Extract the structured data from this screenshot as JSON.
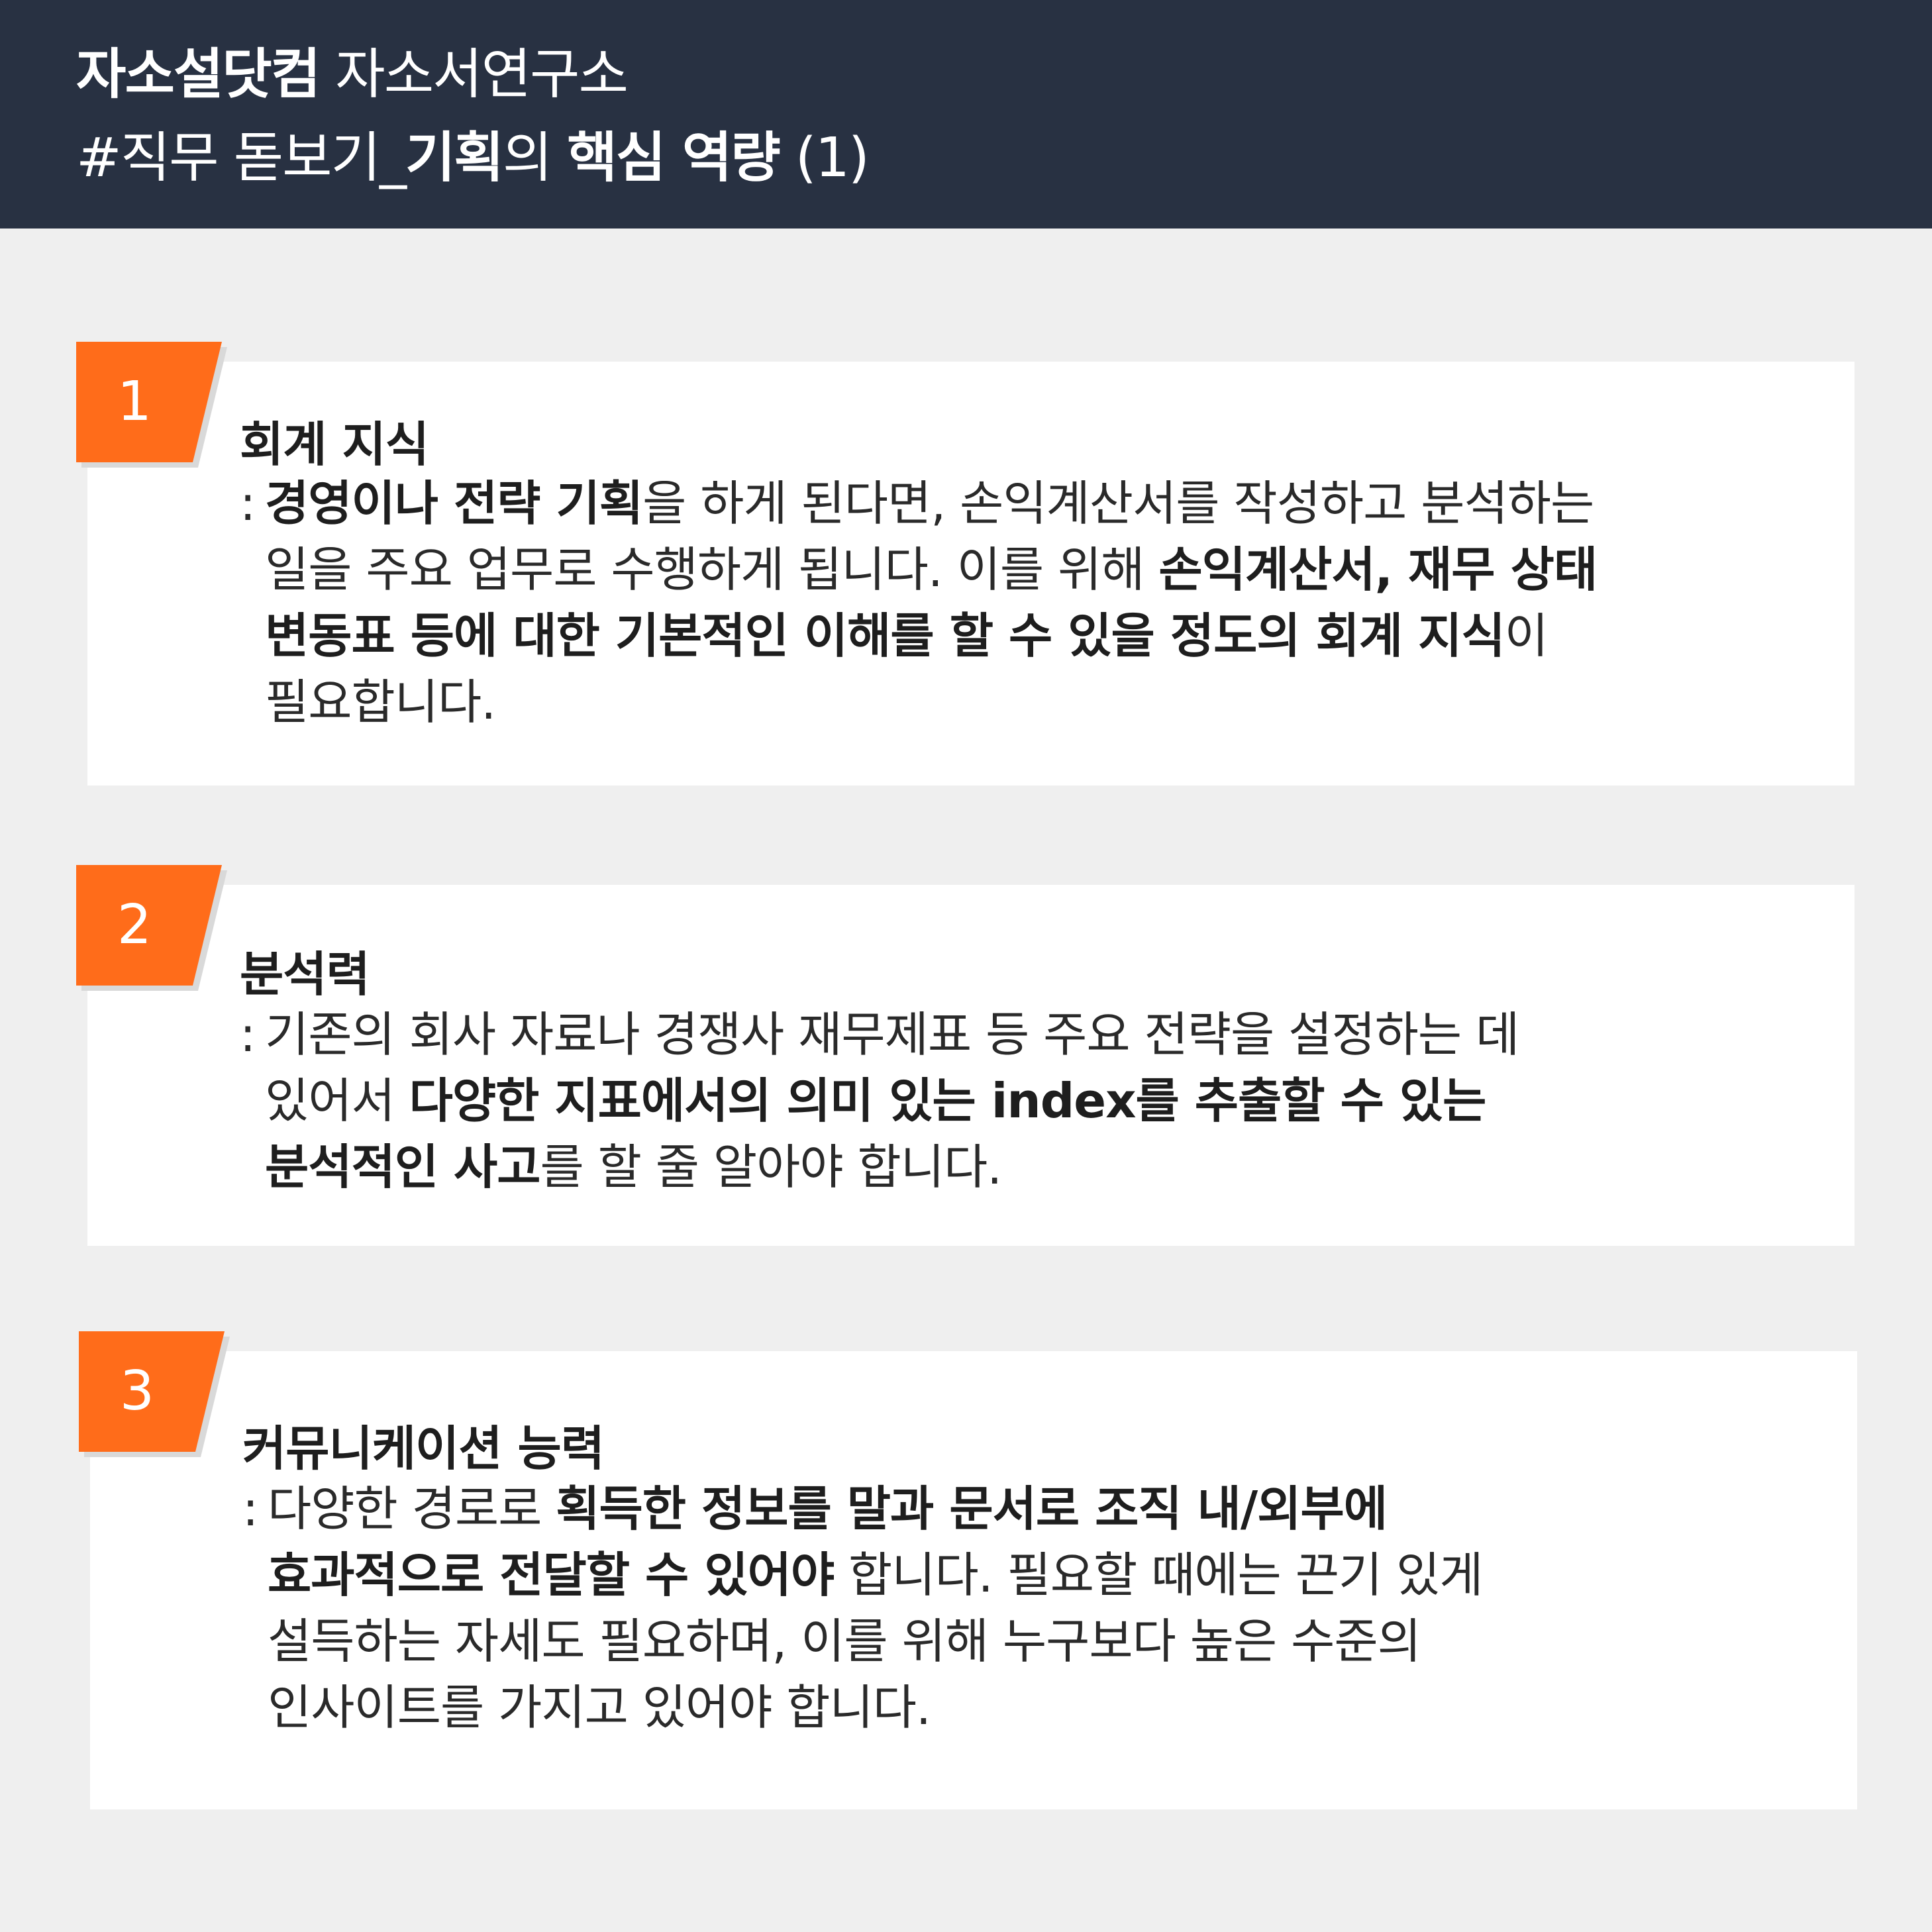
{
  "header": {
    "line1_bold": "자소설닷컴",
    "line1_normal": " 자소서연구소",
    "line2_a": "#직무 돋보기_",
    "line2_b": "기획",
    "line2_c": "의 ",
    "line2_d": "핵심 역량",
    "line2_e": " (1)"
  },
  "sections": [
    {
      "number": "1",
      "title": "회계 지식",
      "colon": ":",
      "lines": [
        [
          {
            "t": "경영이나 전략 기획",
            "b": true
          },
          {
            "t": "을 하게 된다면, 손익계산서를 작성하고 분석하는",
            "b": false
          }
        ],
        [
          {
            "t": "일을 주요 업무로 수행하게 됩니다. 이를 위해 ",
            "b": false
          },
          {
            "t": "손익계산서, 재무 상태",
            "b": true
          }
        ],
        [
          {
            "t": "변동표 등에 대한 기본적인 이해를 할 수 있을 정도의 회계 지식",
            "b": true
          },
          {
            "t": "이",
            "b": false
          }
        ],
        [
          {
            "t": "필요합니다.",
            "b": false
          }
        ]
      ]
    },
    {
      "number": "2",
      "title": "분석력",
      "colon": ":",
      "lines": [
        [
          {
            "t": "기존의 회사 자료나 경쟁사 재무제표 등 주요 전략을 설정하는 데",
            "b": false
          }
        ],
        [
          {
            "t": "있어서 ",
            "b": false
          },
          {
            "t": "다양한 지표에서의 의미 있는 index를 추출할 수 있는",
            "b": true
          }
        ],
        [
          {
            "t": "분석적인 사고",
            "b": true
          },
          {
            "t": "를 할 줄 알아야 합니다.",
            "b": false
          }
        ]
      ]
    },
    {
      "number": "3",
      "title": "커뮤니케이션 능력",
      "colon": ":",
      "lines": [
        [
          {
            "t": "다양한 경로로 ",
            "b": false
          },
          {
            "t": "획득한 정보를 말과 문서로 조직 내/외부에",
            "b": true
          }
        ],
        [
          {
            "t": "효과적으로 전달할 수 있어야",
            "b": true
          },
          {
            "t": " 합니다. 필요할 때에는 끈기 있게",
            "b": false
          }
        ],
        [
          {
            "t": "설득하는 자세도 필요하며, 이를 위해 누구보다 높은 수준의",
            "b": false
          }
        ],
        [
          {
            "t": "인사이트를 가지고 있어야 합니다.",
            "b": false
          }
        ]
      ]
    }
  ],
  "colors": {
    "header_bg": "#283142",
    "accent": "#ff6c1a",
    "page_bg": "#efefef",
    "card_bg": "#ffffff"
  }
}
